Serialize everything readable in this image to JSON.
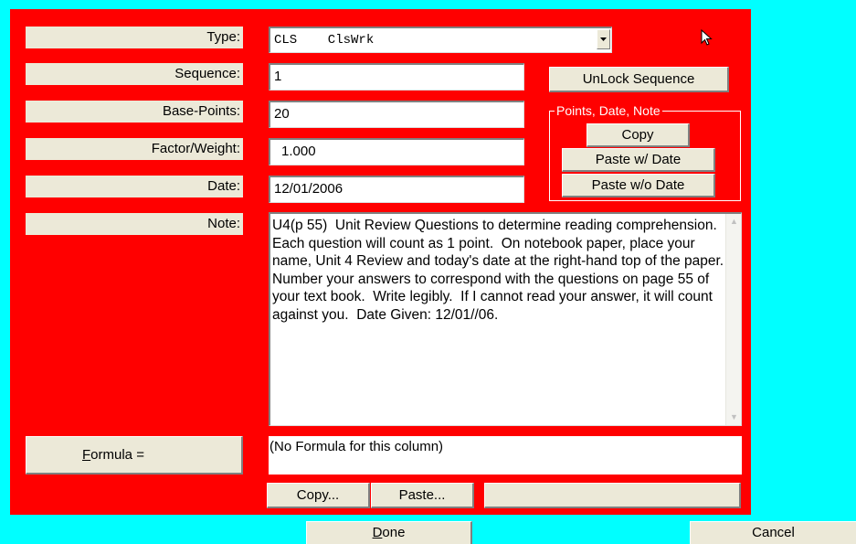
{
  "fields": {
    "type": {
      "label": "Type:",
      "value": "CLS    ClsWrk"
    },
    "sequence": {
      "label": "Sequence:",
      "value": "1"
    },
    "base_points": {
      "label": "Base-Points:",
      "value": "20"
    },
    "factor_weight": {
      "label": "Factor/Weight:",
      "value": "1.000"
    },
    "date": {
      "label": "Date:",
      "value": "12/01/2006"
    },
    "note": {
      "label": "Note:",
      "value": "U4(p 55)  Unit Review Questions to determine reading comprehension.  Each question will count as 1 point.  On notebook paper, place your name, Unit 4 Review and today's date at the right-hand top of the paper.  Number your answers to correspond with the questions on page 55 of your text book.  Write legibly.  If I cannot read your answer, it will count against you.  Date Given: 12/01//06."
    }
  },
  "unlock_sequence": "UnLock Sequence",
  "group": {
    "legend": "Points, Date, Note",
    "copy": "Copy",
    "paste_with_date": "Paste w/ Date",
    "paste_without_date": "Paste w/o Date"
  },
  "formula": {
    "button_label_accel": "F",
    "button_label_rest": "ormula =",
    "value": "(No Formula for this column)",
    "copy": "Copy...",
    "paste": "Paste..."
  },
  "footer": {
    "done_accel": "D",
    "done_rest": "one",
    "cancel": "Cancel"
  },
  "icons": {
    "dropdown": "chevron-down-icon",
    "cursor": "mouse-pointer-icon"
  },
  "colors": {
    "panel": "#ff0000",
    "background": "#00ffff",
    "button_face": "#ece9d8"
  }
}
